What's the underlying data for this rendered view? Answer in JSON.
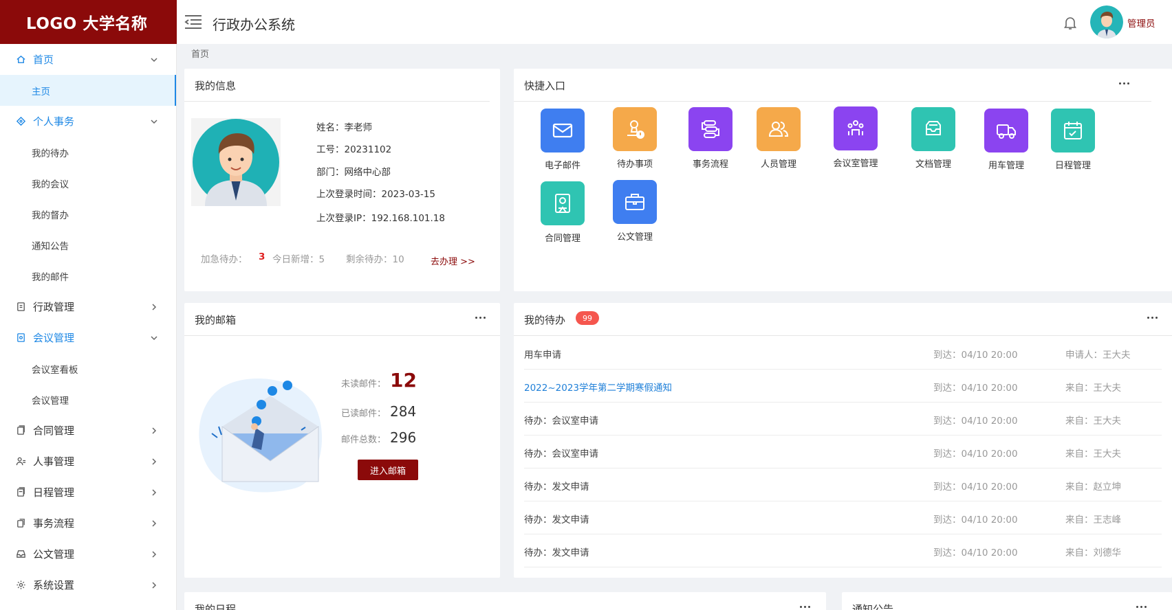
{
  "brand": {
    "logo_text": "LOGO 大学名称",
    "color": "#8b0a0a"
  },
  "header": {
    "title": "行政办公系统",
    "user_name": "管理员"
  },
  "breadcrumb": "首页",
  "sidebar": {
    "home": {
      "label": "首页",
      "subs": [
        "主页"
      ]
    },
    "personal": {
      "label": "个人事务",
      "subs": [
        "我的待办",
        "我的会议",
        "我的督办",
        "通知公告",
        "我的邮件"
      ]
    },
    "admin": {
      "label": "行政管理"
    },
    "meeting": {
      "label": "会议管理",
      "subs": [
        "会议室看板",
        "会议管理"
      ]
    },
    "contract": {
      "label": "合同管理"
    },
    "hr": {
      "label": "人事管理"
    },
    "schedule": {
      "label": "日程管理"
    },
    "workflow": {
      "label": "事务流程"
    },
    "document": {
      "label": "公文管理"
    },
    "settings": {
      "label": "系统设置"
    }
  },
  "info_card": {
    "title": "我的信息",
    "name": "姓名：李老师",
    "id": "工号：20231102",
    "dept": "部门：网络中心部",
    "last_login": "上次登录时间：2023-03-15",
    "last_ip": "上次登录IP：192.168.101.18",
    "urgent_label": "加急待办：",
    "urgent_value": "3",
    "new_today": "今日新增：5",
    "remaining": "剩余待办：10",
    "go_link": "去办理 >>"
  },
  "quick": {
    "title": "快捷入口",
    "items": [
      {
        "label": "电子邮件",
        "color": "#3f7ef0",
        "icon": "mail-icon"
      },
      {
        "label": "待办事项",
        "color": "#f5a94a",
        "icon": "stamp-icon"
      },
      {
        "label": "事务流程",
        "color": "#8b44f0",
        "icon": "flow-icon"
      },
      {
        "label": "人员管理",
        "color": "#f5a94a",
        "icon": "people-icon"
      },
      {
        "label": "会议室管理",
        "color": "#8b44f0",
        "icon": "meeting-icon"
      },
      {
        "label": "文档管理",
        "color": "#2fc4b2",
        "icon": "archive-icon"
      },
      {
        "label": "用车管理",
        "color": "#8b44f0",
        "icon": "truck-icon"
      },
      {
        "label": "日程管理",
        "color": "#2fc4b2",
        "icon": "calendar-icon"
      },
      {
        "label": "合同管理",
        "color": "#2fc4b2",
        "icon": "contract-icon"
      },
      {
        "label": "公文管理",
        "color": "#3f7ef0",
        "icon": "briefcase-icon"
      }
    ]
  },
  "mailbox": {
    "title": "我的邮箱",
    "unread_label": "未读邮件：",
    "unread_value": "12",
    "read_label": "已读邮件：",
    "read_value": "284",
    "total_label": "邮件总数：",
    "total_value": "296",
    "button": "进入邮箱"
  },
  "todo": {
    "title": "我的待办",
    "badge": "99",
    "rows": [
      {
        "title": "用车申请",
        "time": "到达：04/10 20:00",
        "from": "申请人：王大夫"
      },
      {
        "title": "2022~2023学年第二学期寒假通知",
        "time": "到达：04/10 20:00",
        "from": "来自：王大夫"
      },
      {
        "title": "待办：会议室申请",
        "time": "到达：04/10 20:00",
        "from": "来自：王大夫"
      },
      {
        "title": "待办：会议室申请",
        "time": "到达：04/10 20:00",
        "from": "来自：王大夫"
      },
      {
        "title": "待办：发文申请",
        "time": "到达：04/10 20:00",
        "from": "来自：赵立坤"
      },
      {
        "title": "待办：发文申请",
        "time": "到达：04/10 20:00",
        "from": "来自：王志峰"
      },
      {
        "title": "待办：发文申请",
        "time": "到达：04/10 20:00",
        "from": "来自：刘德华"
      }
    ]
  },
  "schedule_card": {
    "title": "我的日程"
  },
  "notice_card": {
    "title": "通知公告"
  }
}
